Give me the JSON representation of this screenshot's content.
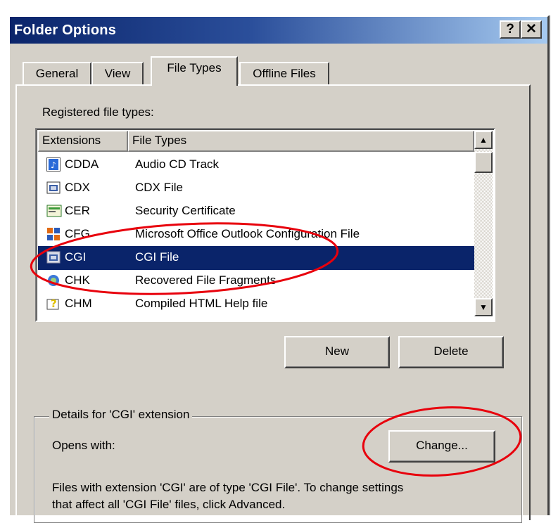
{
  "window": {
    "title": "Folder Options"
  },
  "caption_buttons": {
    "help": "?",
    "close": "✕"
  },
  "tabs": [
    {
      "label": "General",
      "active": false
    },
    {
      "label": "View",
      "active": false
    },
    {
      "label": "File Types",
      "active": true
    },
    {
      "label": "Offline Files",
      "active": false
    }
  ],
  "registered_label": "Registered file types:",
  "list": {
    "columns": {
      "extensions": "Extensions",
      "file_types": "File Types"
    },
    "rows": [
      {
        "ext": "CDDA",
        "type": "Audio CD Track",
        "icon": "audio-cd-icon",
        "selected": false
      },
      {
        "ext": "CDX",
        "type": "CDX File",
        "icon": "generic-file-icon",
        "selected": false
      },
      {
        "ext": "CER",
        "type": "Security Certificate",
        "icon": "certificate-icon",
        "selected": false
      },
      {
        "ext": "CFG",
        "type": "Microsoft Office Outlook Configuration File",
        "icon": "outlook-config-icon",
        "selected": false
      },
      {
        "ext": "CGI",
        "type": "CGI File",
        "icon": "generic-file-icon",
        "selected": true
      },
      {
        "ext": "CHK",
        "type": "Recovered File Fragments",
        "icon": "recovered-fragment-icon",
        "selected": false
      },
      {
        "ext": "CHM",
        "type": "Compiled HTML Help file",
        "icon": "help-file-icon",
        "selected": false
      }
    ]
  },
  "buttons": {
    "new": "New",
    "delete": "Delete",
    "change": "Change..."
  },
  "details": {
    "group_title": "Details for 'CGI' extension",
    "opens_with": "Opens with:",
    "description_line1": "Files with extension 'CGI' are of type 'CGI File'.  To change settings",
    "description_line2": "that affect all 'CGI File' files, click Advanced."
  },
  "annotation_color": "#e8000c"
}
